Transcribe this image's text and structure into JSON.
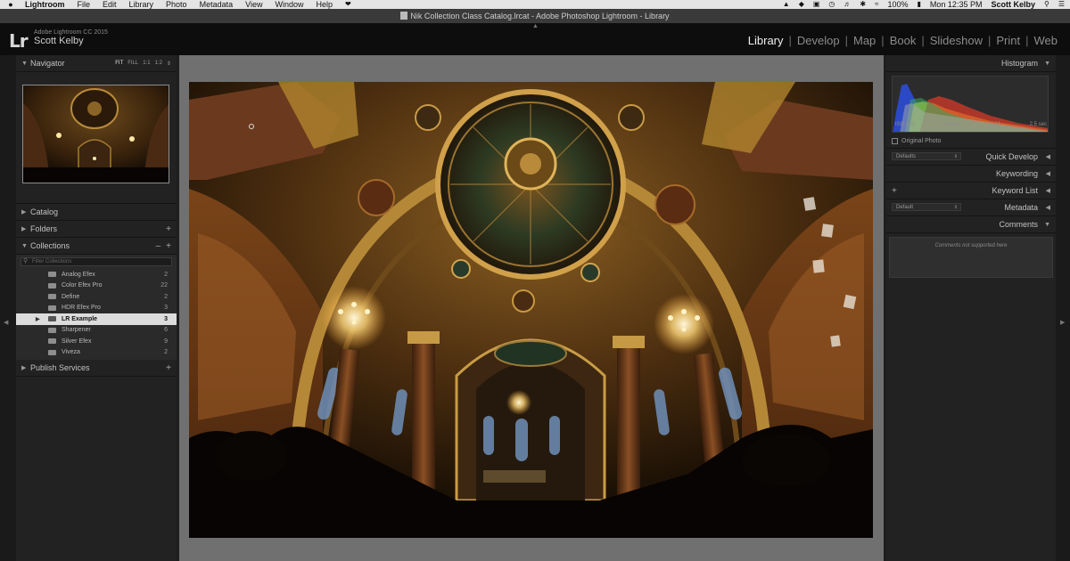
{
  "menubar": {
    "app": "Lightroom",
    "items": [
      "File",
      "Edit",
      "Library",
      "Photo",
      "Metadata",
      "View",
      "Window",
      "Help"
    ],
    "battery": "100%",
    "clock": "Mon 12:35 PM",
    "user": "Scott Kelby"
  },
  "window": {
    "title": "Nik Collection Class Catalog.lrcat - Adobe Photoshop Lightroom - Library"
  },
  "identity": {
    "logo": "Lr",
    "product": "Adobe Lightroom CC 2015",
    "user": "Scott Kelby"
  },
  "modules": [
    {
      "label": "Library",
      "active": true
    },
    {
      "label": "Develop"
    },
    {
      "label": "Map"
    },
    {
      "label": "Book"
    },
    {
      "label": "Slideshow"
    },
    {
      "label": "Print"
    },
    {
      "label": "Web"
    }
  ],
  "left_panel": {
    "navigator": {
      "title": "Navigator",
      "zooms": [
        "FIT",
        "FILL",
        "1:1",
        "1:2"
      ]
    },
    "catalog": {
      "title": "Catalog"
    },
    "folders": {
      "title": "Folders"
    },
    "collections": {
      "title": "Collections",
      "search_placeholder": "Filter Collections",
      "items": [
        {
          "name": "Analog Efex",
          "count": "2"
        },
        {
          "name": "Color Efex Pro",
          "count": "22"
        },
        {
          "name": "Define",
          "count": "2"
        },
        {
          "name": "HDR Efex Pro",
          "count": "3"
        },
        {
          "name": "LR Example",
          "count": "3",
          "selected": true
        },
        {
          "name": "Sharpener",
          "count": "6"
        },
        {
          "name": "Silver Efex",
          "count": "9"
        },
        {
          "name": "Viveza",
          "count": "2"
        }
      ]
    },
    "publish": {
      "title": "Publish Services"
    }
  },
  "right_panel": {
    "histogram": {
      "title": "Histogram",
      "iso": "ISO 100",
      "focal": "14 mm",
      "aperture": "f / 11",
      "shutter": "2.5 sec",
      "original_label": "Original Photo"
    },
    "quick_develop": {
      "title": "Quick Develop",
      "preset": "Defaults"
    },
    "keywording": {
      "title": "Keywording"
    },
    "keyword_list": {
      "title": "Keyword List"
    },
    "metadata": {
      "title": "Metadata",
      "preset": "Default"
    },
    "comments": {
      "title": "Comments",
      "message": "Comments not supported here"
    }
  },
  "colors": {
    "accent_selected_row": "#dcdcdc",
    "center_bg": "#707070",
    "panel_bg": "#222222"
  }
}
